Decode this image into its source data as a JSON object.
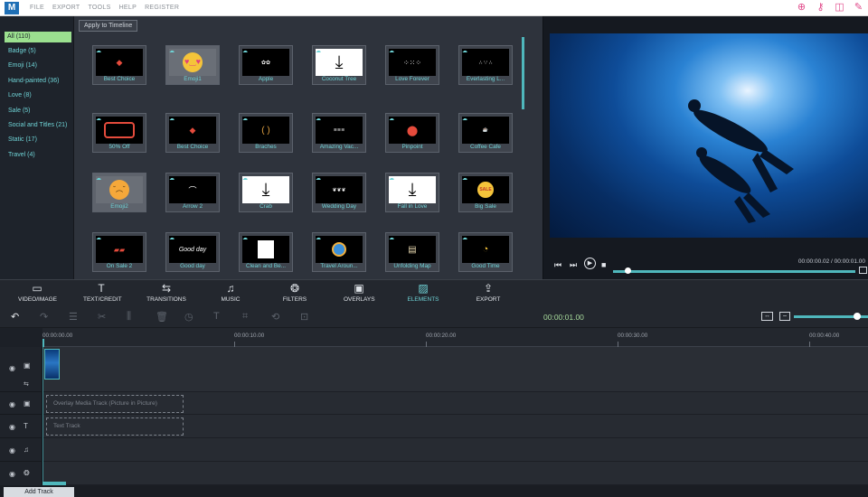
{
  "menu": {
    "logo_text": "M",
    "items": [
      "FILE",
      "EXPORT",
      "TOOLS",
      "HELP",
      "REGISTER"
    ]
  },
  "top_icons": [
    "gift-icon",
    "key-icon",
    "layout-icon",
    "edit-icon"
  ],
  "sidebar": {
    "items": [
      {
        "label": "All (110)",
        "active": true
      },
      {
        "label": "Badge (5)"
      },
      {
        "label": "Emoji (14)"
      },
      {
        "label": "Hand-painted (36)"
      },
      {
        "label": "Love (8)"
      },
      {
        "label": "Sale (5)"
      },
      {
        "label": "Social and Titles (21)"
      },
      {
        "label": "Static (17)"
      },
      {
        "label": "Travel (4)"
      }
    ]
  },
  "grid": {
    "apply_label": "Apply to Timeline",
    "rows": [
      [
        "Best Choice",
        "Emoji1",
        "Apple",
        "Coconut Tree",
        "Love Forever",
        "Everlasting L..."
      ],
      [
        "50% Off",
        "Best Choice",
        "Braches",
        "Amazing Vac...",
        "Pinpoint",
        "Coffee Cafe"
      ],
      [
        "Emoji2",
        "Arrow 2",
        "Crab",
        "Wedding Day",
        "Fall in Love",
        "Big Sale"
      ],
      [
        "On Sale 2",
        "Good day",
        "Clean and Be...",
        "Travel Aroun...",
        "Unfolding Map",
        "Good Time"
      ]
    ],
    "thumb_texts": {
      "good_day": "Good day",
      "sale_badge": "SALE"
    }
  },
  "player": {
    "timecode": "00:00:00.02 / 00:00:01.00",
    "progress": 0.06
  },
  "tabs": [
    {
      "label": "VIDEO/IMAGE",
      "icon": "folder-icon",
      "glyph": "▭"
    },
    {
      "label": "TEXT/CREDIT",
      "icon": "text-icon",
      "glyph": "T"
    },
    {
      "label": "TRANSITIONS",
      "icon": "transitions-icon",
      "glyph": "⇆"
    },
    {
      "label": "MUSIC",
      "icon": "music-icon",
      "glyph": "♫"
    },
    {
      "label": "FILTERS",
      "icon": "filters-icon",
      "glyph": "❂"
    },
    {
      "label": "OVERLAYS",
      "icon": "overlays-icon",
      "glyph": "▣"
    },
    {
      "label": "ELEMENTS",
      "icon": "elements-icon",
      "glyph": "▨",
      "active": true
    },
    {
      "label": "EXPORT",
      "icon": "export-icon",
      "glyph": "⇪"
    }
  ],
  "edit_toolbar": {
    "current_time": "00:00:01.00",
    "zoom_level": 0.8
  },
  "ruler": {
    "labels": [
      "00:00:00.00",
      "00:00:10.00",
      "00:00:20.00",
      "00:00:30.00",
      "00:00:40.00"
    ]
  },
  "tracks": {
    "overlay_placeholder": "Overlay Media Track (Picture in Picture)",
    "text_placeholder": "Text Track",
    "add_track_label": "Add Track"
  },
  "colors": {
    "accent": "#4fb7bc",
    "active_green": "#9be08f",
    "time_green": "#a6d99b"
  }
}
